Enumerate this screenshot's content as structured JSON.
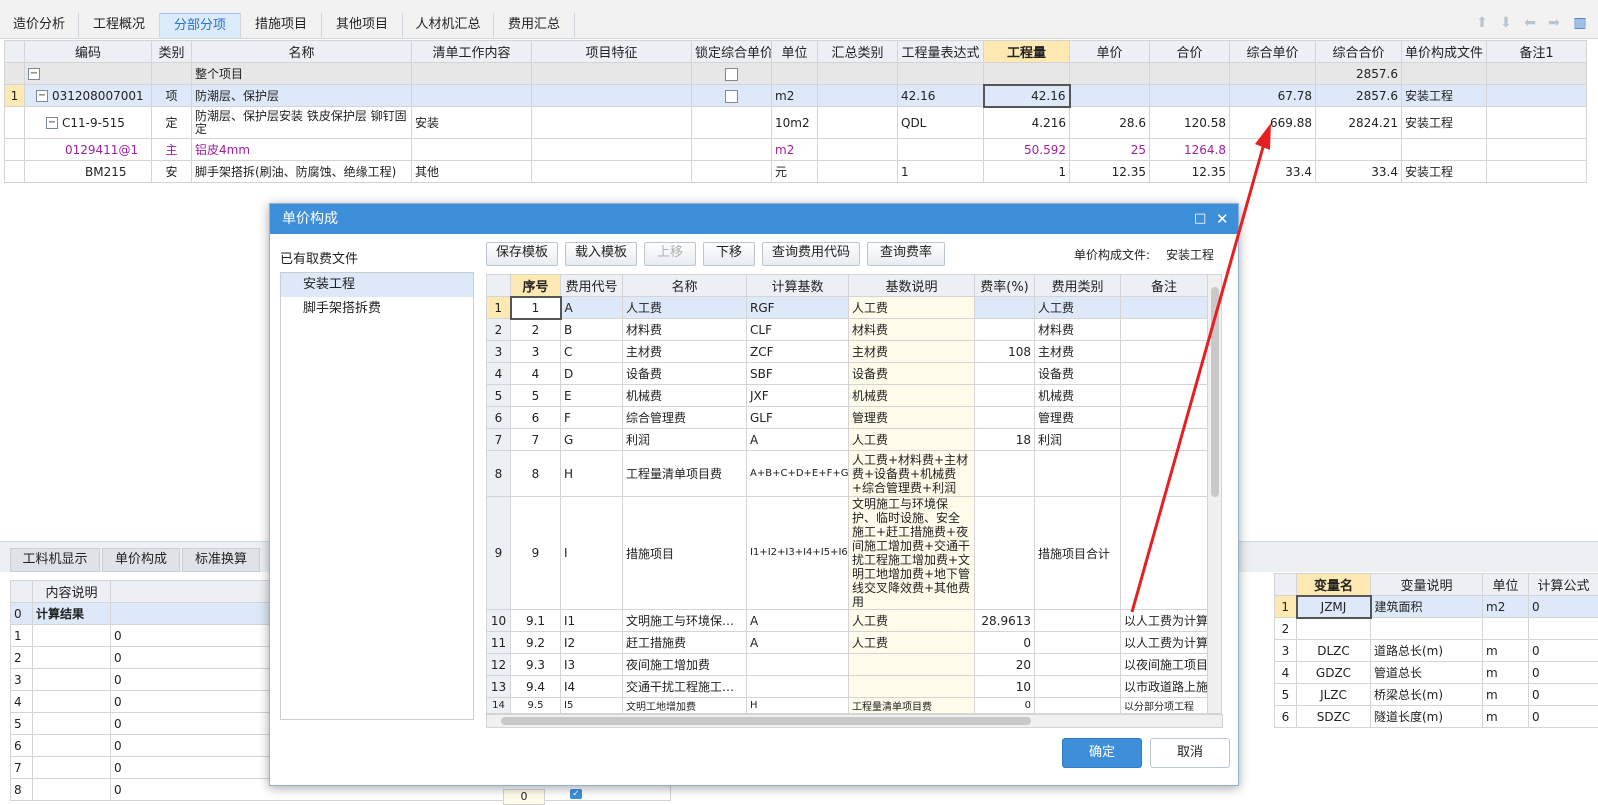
{
  "top_tabs": [
    "造价分析",
    "工程概况",
    "分部分项",
    "措施项目",
    "其他项目",
    "人材机汇总",
    "费用汇总"
  ],
  "main_grid": {
    "headers": [
      "编码",
      "类别",
      "名称",
      "清单工作内容",
      "项目特征",
      "锁定综合单价",
      "单位",
      "汇总类别",
      "工程量表达式",
      "工程量",
      "单价",
      "合价",
      "综合单价",
      "综合合价",
      "单价构成文件",
      "备注1"
    ],
    "total_row": {
      "name": "整个项目",
      "total": "2857.6"
    },
    "rows": [
      {
        "idx": "1",
        "code": "031208007001",
        "type": "项",
        "name": "防潮层、保护层",
        "content": "",
        "unit": "m2",
        "expr": "42.16",
        "qty": "42.16",
        "price": "",
        "amount": "",
        "unit_price": "67.78",
        "total": "2857.6",
        "file": "安装工程"
      },
      {
        "idx": "",
        "code": "C11-9-515",
        "type": "定",
        "name": "防潮层、保护层安装 铁皮保护层 铆钉固定",
        "content": "安装",
        "unit": "10m2",
        "expr": "QDL",
        "qty": "4.216",
        "price": "28.6",
        "amount": "120.58",
        "unit_price": "669.88",
        "total": "2824.21",
        "file": "安装工程"
      },
      {
        "idx": "",
        "code": "0129411@1",
        "type": "主",
        "name": "铝皮4mm",
        "content": "",
        "unit": "m2",
        "expr": "",
        "qty": "50.592",
        "price": "25",
        "amount": "1264.8",
        "unit_price": "",
        "total": "",
        "file": ""
      },
      {
        "idx": "",
        "code": "BM215",
        "type": "安",
        "name": "脚手架搭拆(刷油、防腐蚀、绝缘工程)",
        "content": "其他",
        "unit": "元",
        "expr": "1",
        "qty": "1",
        "price": "12.35",
        "amount": "12.35",
        "unit_price": "33.4",
        "total": "33.4",
        "file": "安装工程"
      }
    ]
  },
  "bottom_tabs": [
    "工料机显示",
    "单价构成",
    "标准换算"
  ],
  "left_grid": {
    "headers": [
      "内容说明"
    ],
    "rows": [
      {
        "idx": "0",
        "desc": "计算结果",
        "val": ""
      },
      {
        "idx": "1",
        "desc": "",
        "val": "0"
      },
      {
        "idx": "2",
        "desc": "",
        "val": "0"
      },
      {
        "idx": "3",
        "desc": "",
        "val": "0"
      },
      {
        "idx": "4",
        "desc": "",
        "val": "0"
      },
      {
        "idx": "5",
        "desc": "",
        "val": "0"
      },
      {
        "idx": "6",
        "desc": "",
        "val": "0"
      },
      {
        "idx": "7",
        "desc": "",
        "val": "0"
      },
      {
        "idx": "8",
        "desc": "",
        "val": "0"
      }
    ],
    "extra_value": "0"
  },
  "right_grid": {
    "headers": [
      "变量名",
      "变量说明",
      "单位",
      "计算公式"
    ],
    "rows": [
      {
        "idx": "1",
        "name": "JZMJ",
        "desc": "建筑面积",
        "unit": "m2",
        "val": "0"
      },
      {
        "idx": "2",
        "name": "",
        "desc": "",
        "unit": "",
        "val": ""
      },
      {
        "idx": "3",
        "name": "DLZC",
        "desc": "道路总长(m)",
        "unit": "m",
        "val": "0"
      },
      {
        "idx": "4",
        "name": "GDZC",
        "desc": "管道总长",
        "unit": "m",
        "val": "0"
      },
      {
        "idx": "5",
        "name": "JLZC",
        "desc": "桥梁总长(m)",
        "unit": "m",
        "val": "0"
      },
      {
        "idx": "6",
        "name": "SDZC",
        "desc": "隧道长度(m)",
        "unit": "m",
        "val": "0"
      }
    ]
  },
  "dialog": {
    "title": "单价构成",
    "file_list_label": "已有取费文件",
    "files": [
      "安装工程",
      "脚手架搭拆费"
    ],
    "buttons": [
      "保存模板",
      "载入模板",
      "上移",
      "下移",
      "查询费用代码",
      "查询费率"
    ],
    "current_file_label": "单价构成文件:",
    "current_file": "安装工程",
    "headers": [
      "序号",
      "费用代号",
      "名称",
      "计算基数",
      "基数说明",
      "费率(%)",
      "费用类别",
      "备注"
    ],
    "rows": [
      {
        "n": "1",
        "seq": "1",
        "code": "A",
        "name": "人工费",
        "base": "RGF",
        "desc": "人工费",
        "rate": "",
        "cat": "人工费",
        "note": ""
      },
      {
        "n": "2",
        "seq": "2",
        "code": "B",
        "name": "材料费",
        "base": "CLF",
        "desc": "材料费",
        "rate": "",
        "cat": "材料费",
        "note": ""
      },
      {
        "n": "3",
        "seq": "3",
        "code": "C",
        "name": "主材费",
        "base": "ZCF",
        "desc": "主材费",
        "rate": "108",
        "cat": "主材费",
        "note": ""
      },
      {
        "n": "4",
        "seq": "4",
        "code": "D",
        "name": "设备费",
        "base": "SBF",
        "desc": "设备费",
        "rate": "",
        "cat": "设备费",
        "note": ""
      },
      {
        "n": "5",
        "seq": "5",
        "code": "E",
        "name": "机械费",
        "base": "JXF",
        "desc": "机械费",
        "rate": "",
        "cat": "机械费",
        "note": ""
      },
      {
        "n": "6",
        "seq": "6",
        "code": "F",
        "name": "综合管理费",
        "base": "GLF",
        "desc": "管理费",
        "rate": "",
        "cat": "管理费",
        "note": ""
      },
      {
        "n": "7",
        "seq": "7",
        "code": "G",
        "name": "利润",
        "base": "A",
        "desc": "人工费",
        "rate": "18",
        "cat": "利润",
        "note": ""
      },
      {
        "n": "8",
        "seq": "8",
        "code": "H",
        "name": "工程量清单项目费",
        "base": "A+B+C+D+E+F+G",
        "desc": "人工费+材料费+主材费+设备费+机械费+综合管理费+利润",
        "rate": "",
        "cat": "",
        "note": ""
      },
      {
        "n": "9",
        "seq": "9",
        "code": "I",
        "name": "措施项目",
        "base": "I1+I2+I3+I4+I5+I6+I7",
        "desc": "文明施工与环境保护、临时设施、安全施工+赶工措施费+夜间施工增加费+交通干扰工程施工增加费+文明工地增加费+地下管线交叉降效费+其他费用",
        "rate": "",
        "cat": "措施项目合计",
        "note": ""
      },
      {
        "n": "10",
        "seq": "9.1",
        "code": "I1",
        "name": "文明施工与环境保…",
        "base": "A",
        "desc": "人工费",
        "rate": "28.9613",
        "cat": "",
        "note": "以人工费为计算"
      },
      {
        "n": "11",
        "seq": "9.2",
        "code": "I2",
        "name": "赶工措施费",
        "base": "A",
        "desc": "人工费",
        "rate": "0",
        "cat": "",
        "note": "以人工费为计算"
      },
      {
        "n": "12",
        "seq": "9.3",
        "code": "I3",
        "name": "夜间施工增加费",
        "base": "",
        "desc": "",
        "rate": "20",
        "cat": "",
        "note": "以夜间施工项目"
      },
      {
        "n": "13",
        "seq": "9.4",
        "code": "I4",
        "name": "交通干扰工程施工…",
        "base": "",
        "desc": "",
        "rate": "10",
        "cat": "",
        "note": "以市政道路上施"
      },
      {
        "n": "14",
        "seq": "9.5",
        "code": "I5",
        "name": "文明工地增加费",
        "base": "H",
        "desc": "工程量清单项目费",
        "rate": "0",
        "cat": "",
        "note": "以分部分项工程"
      }
    ],
    "ok": "确定",
    "cancel": "取消"
  },
  "colors": {
    "accent": "#3e8fd9",
    "annotation": "#e62020",
    "purple": "#a020a0"
  }
}
